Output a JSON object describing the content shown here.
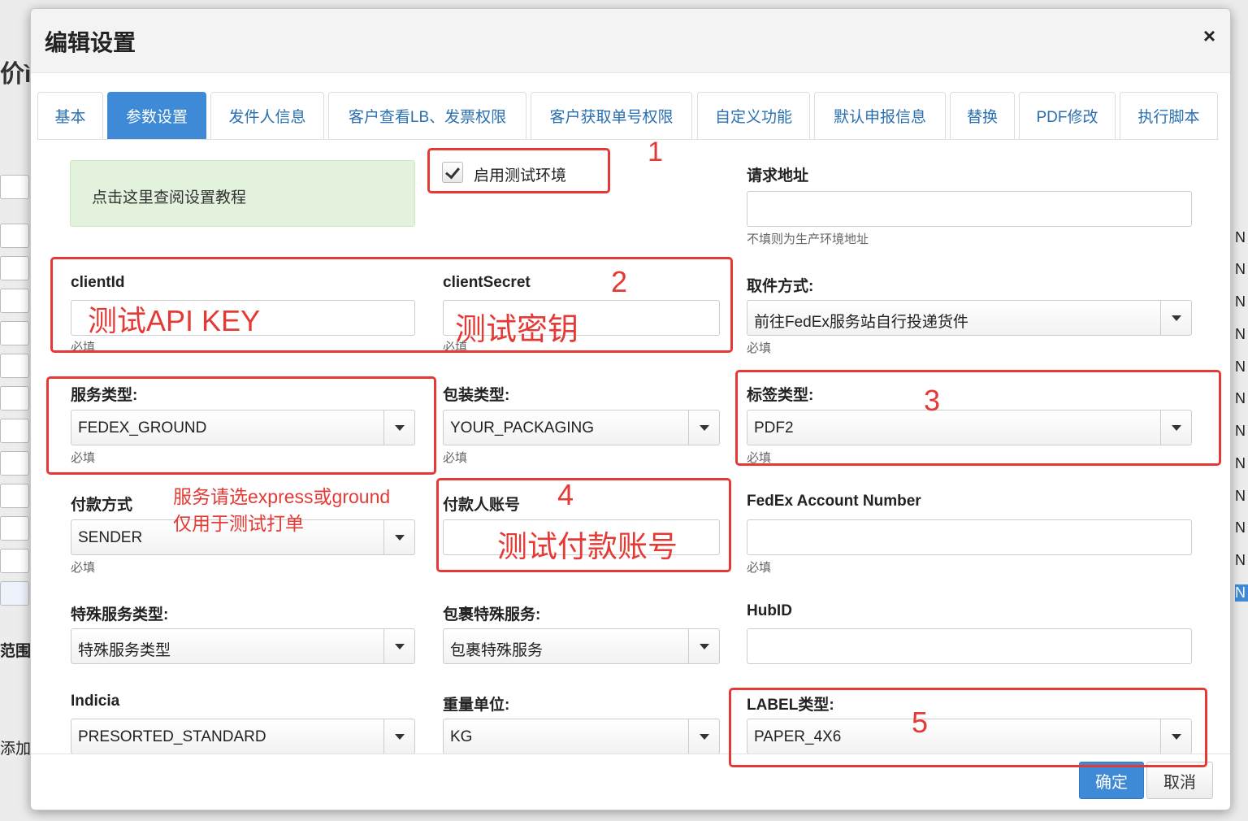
{
  "background": {
    "heading_fragment": "价ì",
    "range_label": "范围",
    "add_label": "添加",
    "right_col_letters": [
      "N",
      "N",
      "N",
      "N",
      "N",
      "N",
      "N",
      "N",
      "N",
      "N",
      "N",
      "N"
    ]
  },
  "modal": {
    "title": "编辑设置",
    "close_glyph": "×",
    "tabs": [
      "基本",
      "参数设置",
      "发件人信息",
      "客户查看LB、发票权限",
      "客户获取单号权限",
      "自定义功能",
      "默认申报信息",
      "替换",
      "PDF修改",
      "执行脚本"
    ],
    "active_tab": "参数设置",
    "tutorial_link": "点击这里查阅设置教程",
    "test_env": {
      "label": "启用测试环境",
      "checked": true
    },
    "request_url": {
      "label": "请求地址",
      "value": "",
      "hint": "不填则为生产环境地址"
    },
    "client_id": {
      "label": "clientId",
      "hint": "必填"
    },
    "client_secret": {
      "label": "clientSecret",
      "hint": "必填"
    },
    "pickup_method": {
      "label": "取件方式:",
      "value": "前往FedEx服务站自行投递货件",
      "hint": "必填"
    },
    "service_type": {
      "label": "服务类型:",
      "value": "FEDEX_GROUND",
      "hint": "必填"
    },
    "package_type": {
      "label": "包装类型:",
      "value": "YOUR_PACKAGING",
      "hint": "必填"
    },
    "label_type": {
      "label": "标签类型:",
      "value": "PDF2",
      "hint": "必填"
    },
    "payment_method": {
      "label": "付款方式",
      "value": "SENDER",
      "hint": "必填"
    },
    "payer_account": {
      "label": "付款人账号"
    },
    "fedex_account": {
      "label": "FedEx Account Number",
      "value": "",
      "hint": "必填"
    },
    "special_service": {
      "label": "特殊服务类型:",
      "value": "特殊服务类型"
    },
    "package_special": {
      "label": "包裹特殊服务:",
      "value": "包裹特殊服务"
    },
    "hub_id": {
      "label": "HubID",
      "value": ""
    },
    "indicia": {
      "label": "Indicia",
      "value": "PRESORTED_STANDARD"
    },
    "weight_unit": {
      "label": "重量单位:",
      "value": "KG"
    },
    "label_stock": {
      "label": "LABEL类型:",
      "value": "PAPER_4X6"
    },
    "confirm_label": "确定",
    "cancel_label": "取消"
  },
  "annotations": {
    "n1": "1",
    "n2": "2",
    "n3": "3",
    "n4": "4",
    "n5": "5",
    "api_key": "测试API KEY",
    "secret": "测试密钥",
    "payer": "测试付款账号",
    "note_line1": "服务请选express或ground",
    "note_line2": "仅用于测试打单"
  },
  "colors": {
    "accent": "#3f8ad6",
    "annotation_red": "#e53935",
    "tip_bg": "#e3f2dd"
  }
}
